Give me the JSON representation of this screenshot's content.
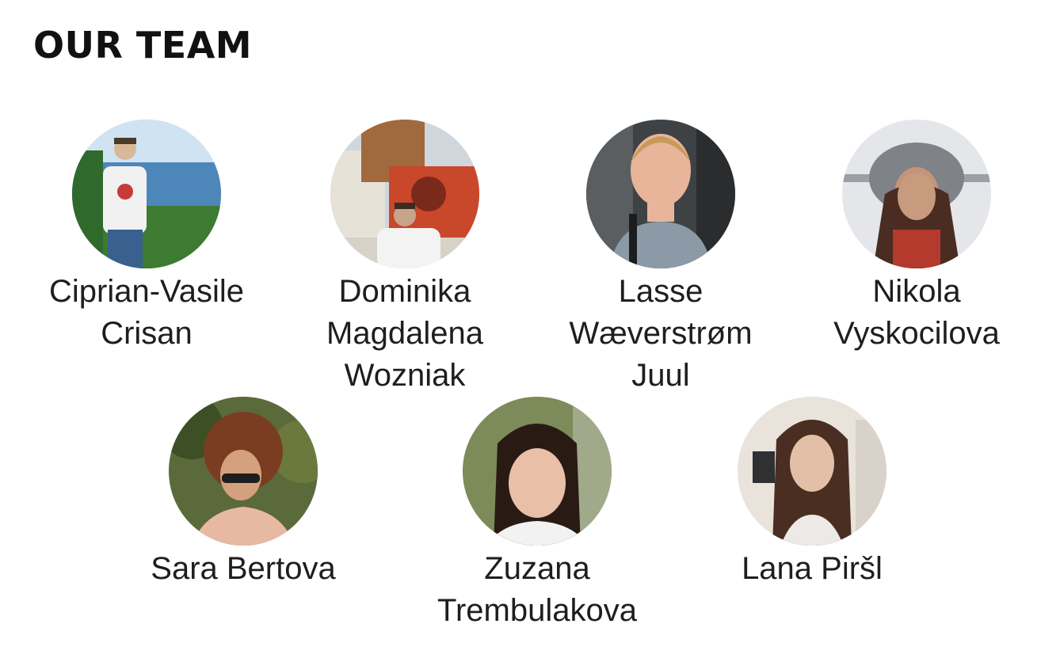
{
  "page": {
    "title": "OUR TEAM"
  },
  "team": [
    {
      "name_lines": [
        "Ciprian-Vasile",
        "Crisan"
      ],
      "photo": "person-photo"
    },
    {
      "name_lines": [
        "Dominika",
        "Magdalena",
        "Wozniak"
      ],
      "photo": "person-photo"
    },
    {
      "name_lines": [
        "Lasse",
        "Wæverstrøm",
        "Juul"
      ],
      "photo": "person-photo"
    },
    {
      "name_lines": [
        "Nikola",
        "Vyskocilova"
      ],
      "photo": "person-photo"
    },
    {
      "name_lines": [
        "Sara Bertova"
      ],
      "photo": "person-photo"
    },
    {
      "name_lines": [
        "Zuzana",
        "Trembulakova"
      ],
      "photo": "person-photo"
    },
    {
      "name_lines": [
        "Lana Piršl"
      ],
      "photo": "person-photo"
    }
  ]
}
